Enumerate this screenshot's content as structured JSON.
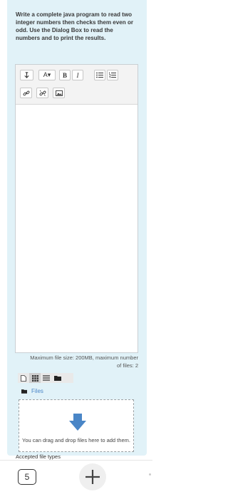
{
  "question": {
    "text": "Write a complete java program to read two integer numbers then checks them even or odd. Use the Dialog Box to read the numbers and to print the results."
  },
  "editor": {
    "toolbar": {
      "paragraph_icon": "paragraph-icon",
      "font_label": "A▾",
      "bold_label": "B",
      "italic_label": "I",
      "bullet_list_icon": "bullet-list-icon",
      "numbered_list_icon": "numbered-list-icon",
      "link_icon": "link-icon",
      "unlink_icon": "unlink-icon",
      "image_icon": "image-icon"
    },
    "content": ""
  },
  "filepicker": {
    "max_info": "Maximum file size: 200MB, maximum number of files: 2",
    "views": [
      "new-file-icon",
      "grid-view-icon",
      "list-view-icon",
      "folder-view-icon"
    ],
    "files_label": "Files",
    "drop_text": "You can drag and drop files here to add them.",
    "accepted_types": "Accepted file types"
  },
  "bottom_nav": {
    "page_number": "5",
    "add_icon": "plus-icon"
  },
  "colors": {
    "card_bg": "#e1f2f8",
    "accent_blue": "#4a86c7"
  }
}
